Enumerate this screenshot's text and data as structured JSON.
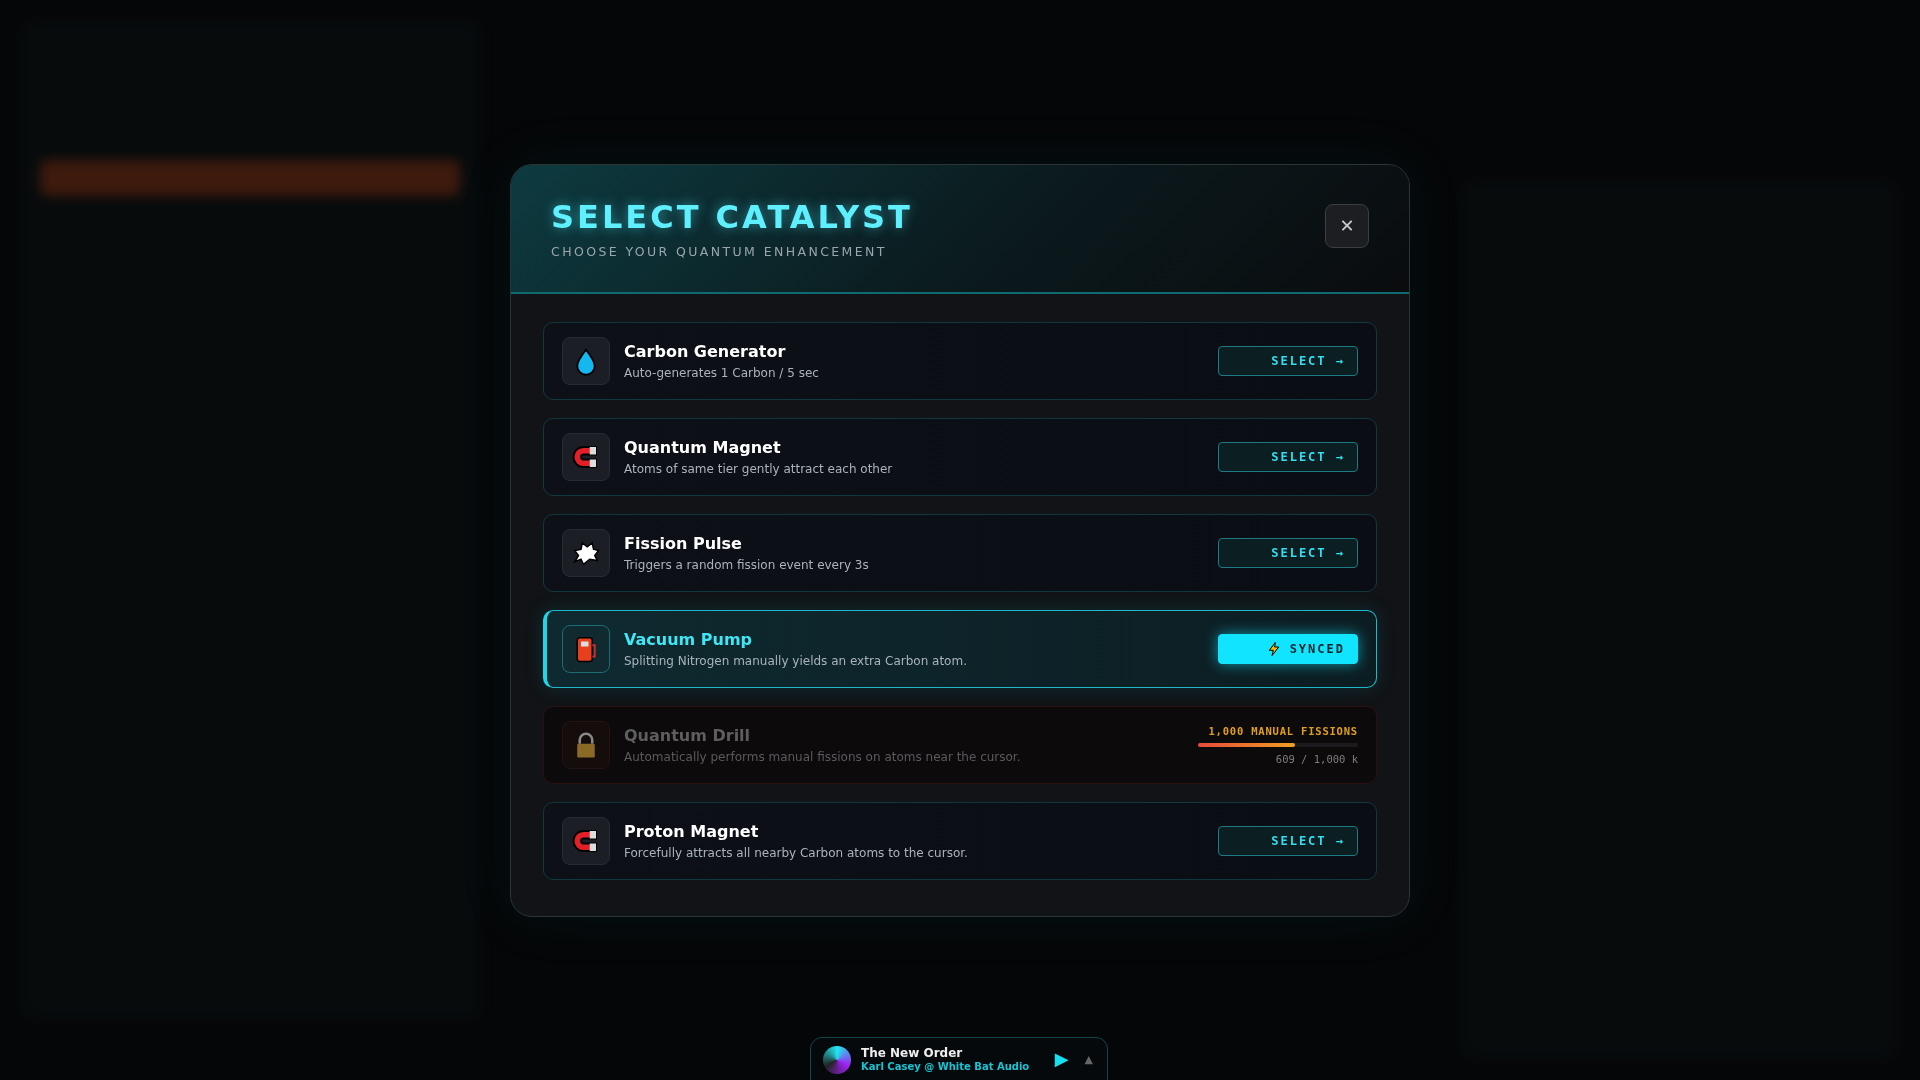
{
  "dialog": {
    "title": "SELECT CATALYST",
    "subtitle": "CHOOSE YOUR QUANTUM ENHANCEMENT",
    "close": "✕"
  },
  "catalysts": [
    {
      "kind": "available",
      "name": "Carbon Generator",
      "description": "Auto-generates 1 Carbon / 5 sec",
      "action": "SELECT →"
    },
    {
      "kind": "available",
      "name": "Quantum Magnet",
      "description": "Atoms of same tier gently attract each other",
      "action": "SELECT →"
    },
    {
      "kind": "available",
      "name": "Fission Pulse",
      "description": "Triggers a random fission event every 3s",
      "action": "SELECT →"
    },
    {
      "kind": "synced",
      "name": "Vacuum Pump",
      "description": "Splitting Nitrogen manually yields an extra Carbon atom.",
      "action": "SYNCED"
    },
    {
      "kind": "locked",
      "name": "Quantum Drill",
      "description": "Automatically performs manual fissions on atoms near the cursor.",
      "requirement": "1,000 MANUAL FISSIONS",
      "level": 0.609,
      "reading": "609 / 1,000 k"
    },
    {
      "kind": "available",
      "name": "Proton Magnet",
      "description": "Forcefully attracts all nearby Carbon atoms to the cursor.",
      "action": "SELECT →"
    }
  ],
  "player": {
    "track": "The New Order",
    "artist": "Karl Casey @ White Bat Audio",
    "play": "▶",
    "expand": "▲"
  }
}
